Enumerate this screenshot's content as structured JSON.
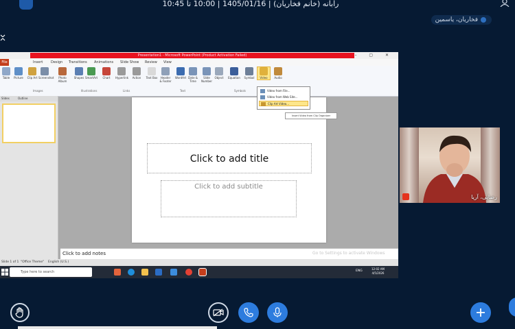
{
  "session": {
    "title": "رابانه (خانم فخاریان) | 1405/01/16 | 10:00 تا 10:45",
    "presenter": "فخاریان، یاسمین"
  },
  "powerpoint": {
    "window_title": "Presentation1 - Microsoft PowerPoint (Product Activation Failed)",
    "tabs": [
      "File",
      "Insert",
      "Design",
      "Transitions",
      "Animations",
      "Slide Show",
      "Review",
      "View"
    ],
    "ribbon": [
      {
        "label": "Table",
        "color": "#8fa7c8"
      },
      {
        "label": "Picture",
        "color": "#5f8fc7"
      },
      {
        "label": "Clip Art",
        "color": "#d0a240"
      },
      {
        "label": "Screenshot",
        "color": "#7b8ea8"
      },
      {
        "label": "Photo Album",
        "color": "#b8683c"
      },
      {
        "label": "Shapes",
        "color": "#5b7fb3"
      },
      {
        "label": "SmartArt",
        "color": "#4a9a52"
      },
      {
        "label": "Chart",
        "color": "#c6463a"
      },
      {
        "label": "Hyperlink",
        "color": "#9a9a9a"
      },
      {
        "label": "Action",
        "color": "#9a9a9a"
      },
      {
        "label": "Text Box",
        "color": "#d9d9d9"
      },
      {
        "label": "Header & Footer",
        "color": "#8fa0b8"
      },
      {
        "label": "WordArt",
        "color": "#3c6cb0"
      },
      {
        "label": "Date & Time",
        "color": "#7a94b8"
      },
      {
        "label": "Slide Number",
        "color": "#7a94b8"
      },
      {
        "label": "Object",
        "color": "#9aa8bb"
      },
      {
        "label": "Equation",
        "color": "#3b5e9a"
      },
      {
        "label": "Symbol",
        "color": "#6d7f98"
      },
      {
        "label": "Video",
        "color": "#e0b13c"
      },
      {
        "label": "Audio",
        "color": "#c08a3c"
      }
    ],
    "groups": [
      "Images",
      "Illustrations",
      "Links",
      "Text",
      "Symbols"
    ],
    "video_menu": {
      "items": [
        "Video from File...",
        "Video from Web Site...",
        "Clip Art Video..."
      ],
      "tooltip": "Insert Video from Clip Organizer"
    },
    "pane_tabs": [
      "Slides",
      "Outline"
    ],
    "slide": {
      "title_placeholder": "Click to add title",
      "subtitle_placeholder": "Click to add subtitle"
    },
    "notes_placeholder": "Click to add notes",
    "activation_watermark": "Go to Settings to activate Windows",
    "status": {
      "slide": "Slide 1 of 1",
      "theme": "\"Office Theme\"",
      "language": "English (U.S.)"
    }
  },
  "taskbar": {
    "search_placeholder": "Type here to search",
    "language": "ENG",
    "time": "12:02 AM",
    "date": "4/5/2026"
  },
  "webcam": {
    "participant": "رضایی، آریا"
  }
}
